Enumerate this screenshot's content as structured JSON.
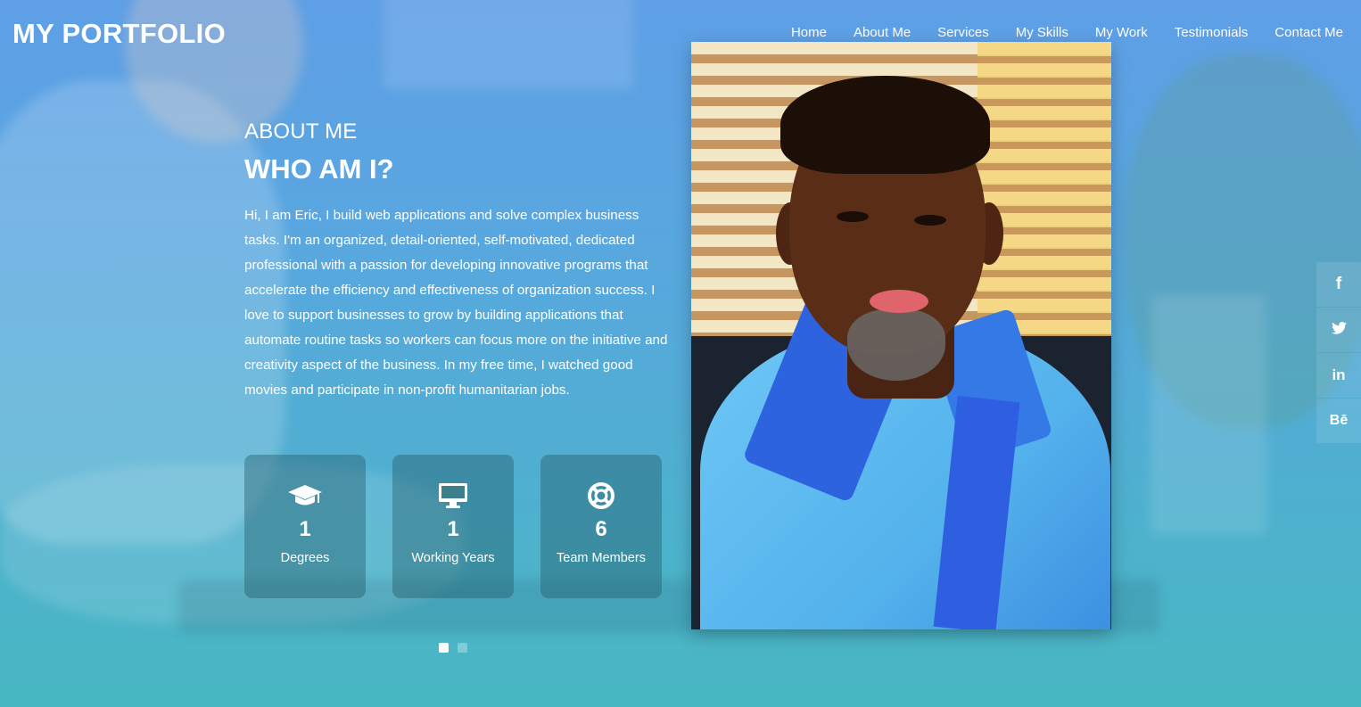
{
  "brand": {
    "logo": "MY PORTFOLIO"
  },
  "nav": {
    "items": [
      {
        "label": "Home"
      },
      {
        "label": "About Me",
        "active": true
      },
      {
        "label": "Services"
      },
      {
        "label": "My Skills"
      },
      {
        "label": "My Work"
      },
      {
        "label": "Testimonials"
      },
      {
        "label": "Contact Me"
      }
    ]
  },
  "about": {
    "eyebrow": "ABOUT ME",
    "title": "WHO AM I?",
    "bio": "Hi, I am Eric, I build web applications and solve complex business tasks. I'm an organized, detail-oriented, self-motivated, dedicated professional with a passion for developing innovative programs that accelerate the efficiency and effectiveness of organization success. I love to support businesses to grow by building applications that automate routine tasks so workers can focus more on the initiative and creativity aspect of the business. In my free time, I watched good movies and participate in non-profit humanitarian jobs."
  },
  "stats": [
    {
      "icon": "graduation-cap-icon",
      "value": "1",
      "label": "Degrees"
    },
    {
      "icon": "desktop-icon",
      "value": "1",
      "label": "Working Years"
    },
    {
      "icon": "life-ring-icon",
      "value": "6",
      "label": "Team Members"
    }
  ],
  "carousel": {
    "slide_count": 2,
    "active_slide": 1
  },
  "social": [
    {
      "icon": "facebook-icon",
      "glyph": "f"
    },
    {
      "icon": "twitter-icon",
      "glyph": ""
    },
    {
      "icon": "linkedin-icon",
      "glyph": "in"
    },
    {
      "icon": "behance-icon",
      "glyph": "Bē"
    }
  ],
  "colors": {
    "background_top": "#5f9fe6",
    "background_bottom": "#48b8c2",
    "text": "#ffffff",
    "card": "#235a69"
  }
}
